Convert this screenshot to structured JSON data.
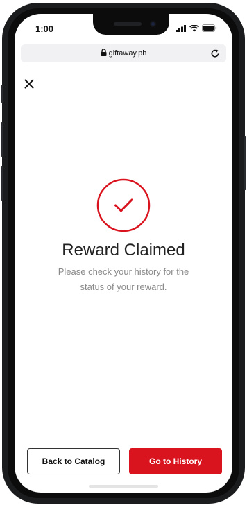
{
  "status_bar": {
    "time": "1:00"
  },
  "browser": {
    "url": "giftaway.ph"
  },
  "success": {
    "title": "Reward Claimed",
    "message": "Please check your history for the status of your reward."
  },
  "actions": {
    "back_label": "Back to Catalog",
    "history_label": "Go to History"
  },
  "colors": {
    "accent": "#d9141f",
    "text_primary": "#222222",
    "text_secondary": "#8a8a8a"
  }
}
